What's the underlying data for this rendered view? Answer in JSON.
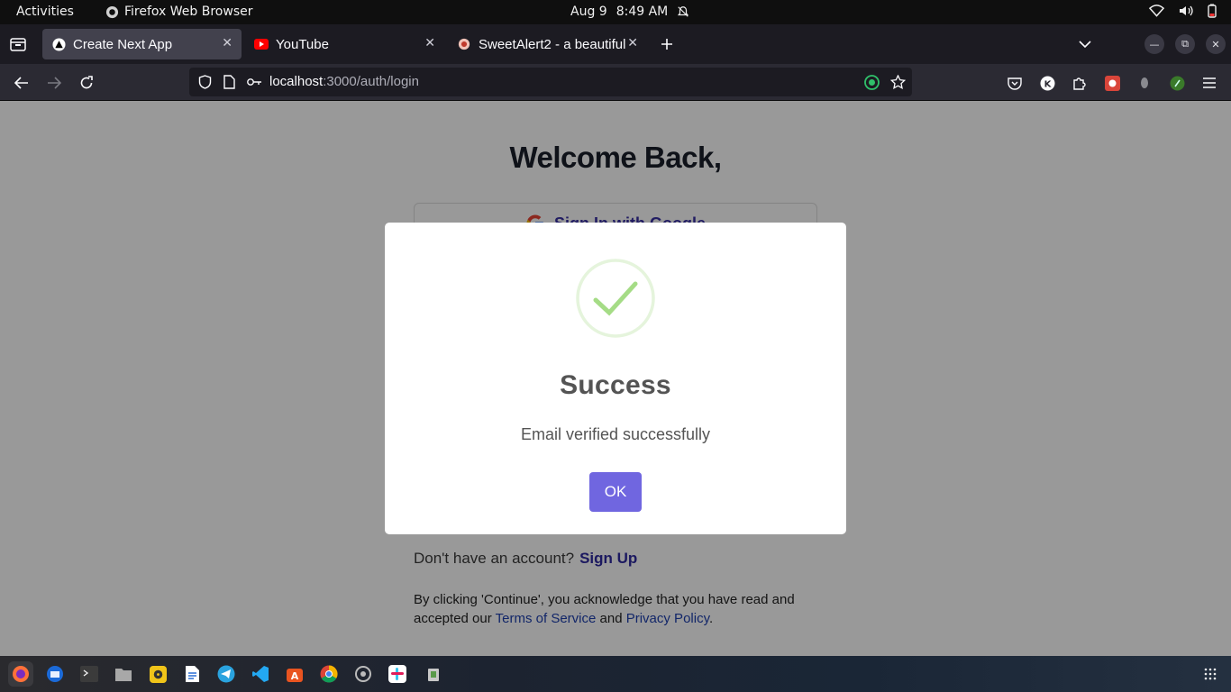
{
  "topbar": {
    "activities": "Activities",
    "app_name": "Firefox Web Browser",
    "date": "Aug 9",
    "time": "8:49 AM"
  },
  "tabs": [
    {
      "title": "Create Next App",
      "active": true
    },
    {
      "title": "YouTube",
      "active": false
    },
    {
      "title": "SweetAlert2 - a beautiful",
      "active": false
    }
  ],
  "urlbar": {
    "host": "localhost",
    "path": ":3000/auth/login"
  },
  "page": {
    "heading": "Welcome Back,",
    "google_button": "Sign In with Google",
    "signup_prompt": "Don't have an account?",
    "signup_link": "Sign Up",
    "legal_prefix": "By clicking 'Continue', you acknowledge that you have read and accepted our",
    "terms_link": "Terms of Service",
    "and": "and",
    "privacy_link": "Privacy Policy",
    "period": "."
  },
  "modal": {
    "title": "Success",
    "message": "Email verified successfully",
    "ok_label": "OK",
    "icon": "success-check-icon"
  },
  "colors": {
    "modal_button": "#7066e0",
    "success_green": "#a5dc86",
    "link_blue": "#1e40af"
  }
}
